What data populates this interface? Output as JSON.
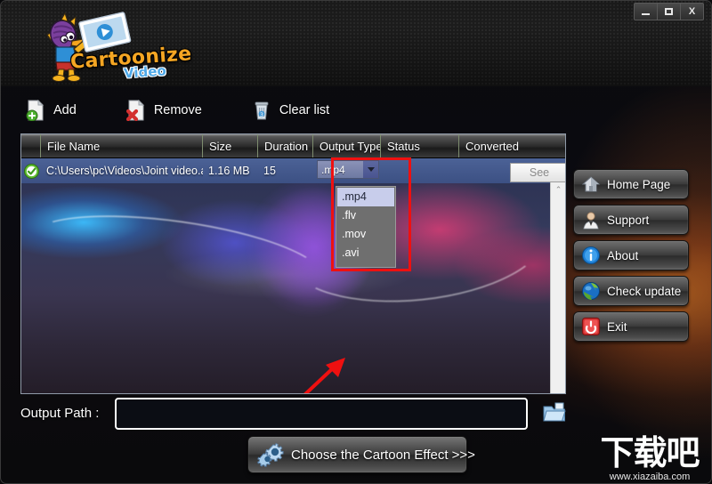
{
  "window": {
    "titlebar": {
      "minimize_label": "–",
      "maximize_label": "☐",
      "close_label": "X"
    }
  },
  "logo": {
    "title": "Cartoonize",
    "subtitle": "Video",
    "title_color": "#F5A623",
    "subtitle_color": "#4FA9E8",
    "mascot_icon": "armadillo-mascot-icon",
    "photo_icon": "photo-card-icon"
  },
  "toolbar": {
    "items": [
      {
        "label": "Add",
        "icon": "add-file-icon"
      },
      {
        "label": "Remove",
        "icon": "remove-file-icon"
      },
      {
        "label": "Clear list",
        "icon": "trash-bin-icon"
      }
    ]
  },
  "file_list": {
    "columns": [
      "",
      "File Name",
      "Size",
      "Duration",
      "Output Type",
      "Status",
      "Converted"
    ],
    "rows": [
      {
        "checked_icon": "green-check-icon",
        "file_name": "C:\\Users\\pc\\Videos\\Joint video.avi",
        "size": "1.16 MB",
        "duration": "15",
        "output_type": ".mp4",
        "status": "",
        "converted_label": "See"
      }
    ],
    "scrollbar": {
      "up_arrow": "⌃",
      "down_arrow": "⌄"
    }
  },
  "output_type_dropdown": {
    "open": true,
    "selected": ".mp4",
    "options": [
      ".mp4",
      ".flv",
      ".mov",
      ".avi"
    ],
    "highlight_color": "#ef1010"
  },
  "side_buttons": [
    {
      "label": "Home Page",
      "icon": "house-icon"
    },
    {
      "label": "Support",
      "icon": "person-support-icon"
    },
    {
      "label": "About",
      "icon": "info-circle-icon"
    },
    {
      "label": "Check update",
      "icon": "refresh-globe-icon"
    },
    {
      "label": "Exit",
      "icon": "power-off-icon"
    }
  ],
  "output_path": {
    "label": "Output Path :",
    "value": "",
    "placeholder": "",
    "browse_icon": "folder-open-icon"
  },
  "choose_button": {
    "label": "Choose the Cartoon Effect >>>",
    "icon": "gears-icon"
  },
  "watermark": {
    "text": "下载吧",
    "url": "www.xiazaiba.com"
  }
}
